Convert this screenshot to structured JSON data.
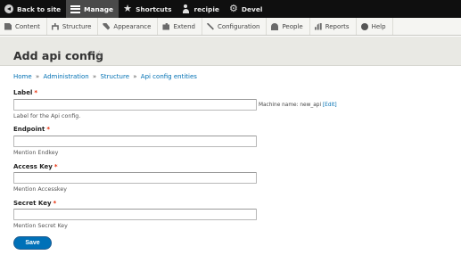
{
  "toolbar": {
    "back_label": "Back to site",
    "manage_label": "Manage",
    "shortcuts_label": "Shortcuts",
    "user_label": "recipie",
    "devel_label": "Devel"
  },
  "tray": {
    "items": [
      {
        "label": "Content",
        "icon": "content-icon"
      },
      {
        "label": "Structure",
        "icon": "structure-icon"
      },
      {
        "label": "Appearance",
        "icon": "appearance-icon"
      },
      {
        "label": "Extend",
        "icon": "extend-icon"
      },
      {
        "label": "Configuration",
        "icon": "configuration-icon"
      },
      {
        "label": "People",
        "icon": "people-icon"
      },
      {
        "label": "Reports",
        "icon": "reports-icon"
      },
      {
        "label": "Help",
        "icon": "help-icon"
      }
    ]
  },
  "page": {
    "title": "Add api config",
    "star": "☆"
  },
  "breadcrumb": {
    "items": [
      "Home",
      "Administration",
      "Structure",
      "Api config entities"
    ],
    "separator": "»"
  },
  "form": {
    "required_mark": "*",
    "label": {
      "label": "Label",
      "value": "",
      "description": "Label for the Api config.",
      "machine_name_prefix": "Machine name: new_api",
      "edit_link": "[Edit]"
    },
    "endpoint": {
      "label": "Endpoint",
      "value": "",
      "description": "Mention Endkey"
    },
    "access_key": {
      "label": "Access Key",
      "value": "",
      "description": "Mention Accesskey"
    },
    "secret_key": {
      "label": "Secret Key",
      "value": "",
      "description": "Mention Secret Key"
    },
    "save_label": "Save"
  },
  "colors": {
    "toolbar_bg": "#0f0f0f",
    "link": "#0070b3",
    "required": "#e62600",
    "primary_button": "#0071b8"
  }
}
